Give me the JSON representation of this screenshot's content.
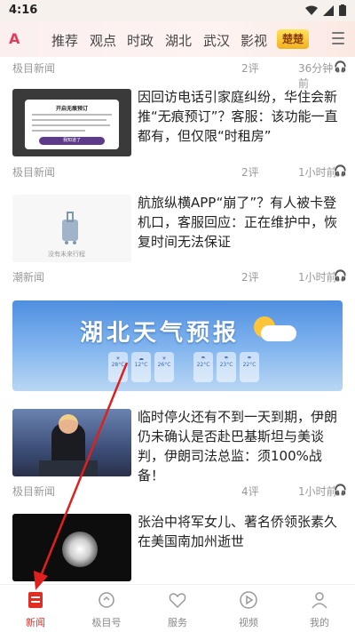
{
  "status_bar": {
    "time": "4:16"
  },
  "top_nav": {
    "logo": "A",
    "tabs": [
      "推荐",
      "观点",
      "时政",
      "湖北",
      "武汉",
      "影视"
    ],
    "badge": "楚楚"
  },
  "feed": {
    "partial_item": {
      "source": "极目新闻",
      "comments": "2评",
      "time": "36分钟前"
    },
    "items": [
      {
        "title": "因回访电话引家庭纠纷，华住会新推“无痕预订”？客服：该功能一直都有，但仅限“时租房”",
        "source": "极目新闻",
        "comments": "2评",
        "time": "1小时前",
        "thumb": {
          "dialog_title": "开启无痕预订",
          "dialog_button": "我知道了"
        }
      },
      {
        "title": "航旅纵横APP“崩了”？有人被卡登机口，客服回应：正在维护中，恢复时间无法保证",
        "source": "潮新闻",
        "comments": "2评",
        "time": "1小时前",
        "thumb": {
          "caption": "没有未来行程"
        }
      },
      {
        "banner_title": "湖北天气预报",
        "temps": [
          "28°C",
          "12°C",
          "26°C",
          "22°C",
          "23°C",
          "22°C"
        ]
      },
      {
        "title": "临时停火还有不到一天到期，伊朗仍未确认是否赴巴基斯坦与美谈判，伊朗司法总监：须100%战备！",
        "source": "极目新闻",
        "comments": "4评",
        "time": "1小时前"
      },
      {
        "title": "张治中将军女儿、著名侨领张素久在美国南加州逝世"
      }
    ]
  },
  "tab_bar": {
    "tabs": [
      {
        "label": "新闻",
        "icon": "news-icon",
        "active": true
      },
      {
        "label": "极目号",
        "icon": "jimu-icon",
        "active": false
      },
      {
        "label": "服务",
        "icon": "service-icon",
        "active": false
      },
      {
        "label": "视频",
        "icon": "video-icon",
        "active": false
      },
      {
        "label": "我的",
        "icon": "profile-icon",
        "active": false
      }
    ]
  },
  "colors": {
    "accent": "#e02e24",
    "arrow": "#e0201e"
  }
}
